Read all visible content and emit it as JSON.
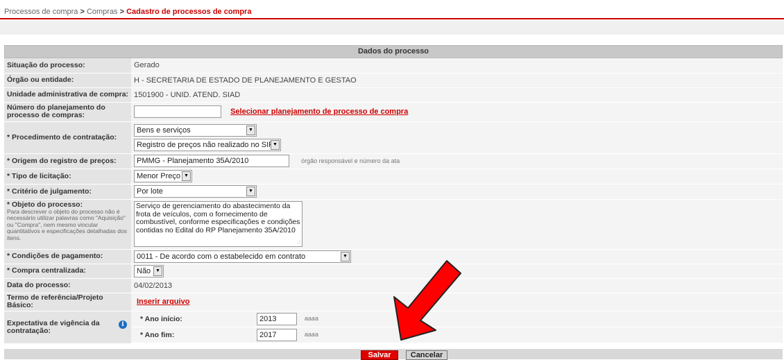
{
  "breadcrumb": {
    "part1": "Processos de compra",
    "sep1": " > ",
    "part2": "Compras",
    "sep2": " > ",
    "current": "Cadastro de processos de compra"
  },
  "panel": {
    "title": "Dados do processo"
  },
  "fields": {
    "situacao": {
      "label": "Situação do processo:",
      "value": "Gerado"
    },
    "orgao": {
      "label": "Órgão ou entidade:",
      "value": "H - SECRETARIA DE ESTADO DE PLANEJAMENTO E GESTAO"
    },
    "unidade": {
      "label": "Unidade administrativa de compra:",
      "value": "1501900 - UNID. ATEND. SIAD"
    },
    "planejamento": {
      "label": "Número do planejamento do processo de compras:",
      "value": "",
      "link": "Selecionar planejamento de processo de compra"
    },
    "procedimento": {
      "label": "* Procedimento de contratação:",
      "select1": "Bens e serviços",
      "select2": "Registro de preços não realizado no SIRP"
    },
    "origem": {
      "label": "* Origem do registro de preços:",
      "value": "PMMG - Planejamento 35A/2010",
      "hint": "órgão responsável e número da ata"
    },
    "tipo": {
      "label": "* Tipo de licitação:",
      "value": "Menor Preço"
    },
    "criterio": {
      "label": "* Critério de julgamento:",
      "value": "Por lote"
    },
    "objeto": {
      "label": "* Objeto do processo:",
      "help": "Para descrever o objeto do processo não é necessário utilizar palavras como \"Aquisição\" ou \"Compra\", nem mesmo vincular quantitativos e especificações detalhadas dos itens.",
      "value": "Serviço de gerenciamento do abastecimento da frota de veículos, com o fornecimento de combustível, conforme especificações e condições contidas no Edital do RP Planejamento 35A/2010"
    },
    "condicoes": {
      "label": "* Condições de pagamento:",
      "value": "0011 - De acordo com o estabelecido em contrato"
    },
    "centralizada": {
      "label": "* Compra centralizada:",
      "value": "Não"
    },
    "data": {
      "label": "Data do processo:",
      "value": "04/02/2013"
    },
    "termo": {
      "label": "Termo de referência/Projeto Básico:",
      "link": "Inserir arquivo"
    },
    "vigencia": {
      "label": "Expectativa de vigência da contratação:",
      "inicio_label": "* Ano início:",
      "inicio_value": "2013",
      "fim_label": "* Ano fim:",
      "fim_value": "2017",
      "unit": "aaaa"
    }
  },
  "buttons": {
    "save": "Salvar",
    "cancel": "Cancelar"
  },
  "colors": {
    "accent": "#cc0000",
    "annotation_arrow": "#ff0000"
  }
}
